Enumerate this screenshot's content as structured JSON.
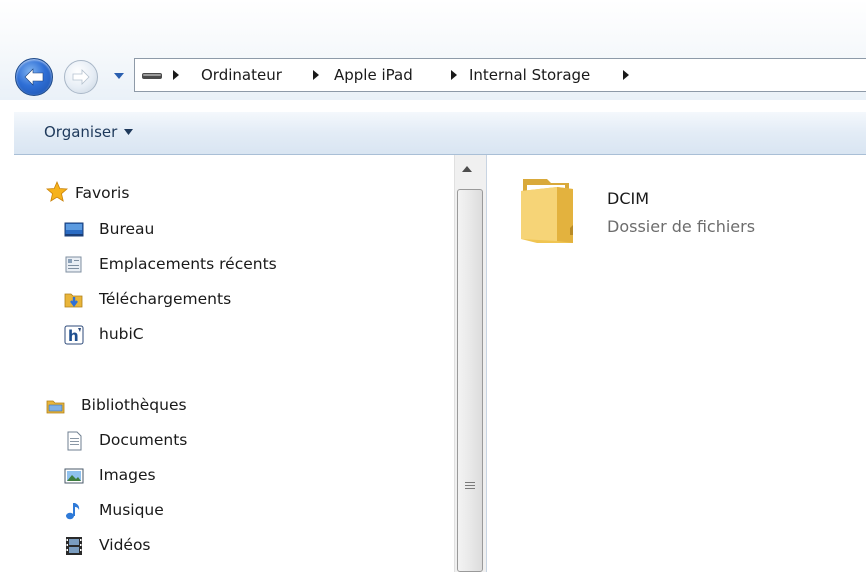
{
  "window": {
    "address_path": [
      "Ordinateur",
      "Apple iPad",
      "Internal Storage"
    ]
  },
  "toolbar": {
    "organise_label": "Organiser"
  },
  "nav": {
    "favorites": {
      "label": "Favoris",
      "items": [
        {
          "label": "Bureau",
          "icon": "desktop-icon"
        },
        {
          "label": "Emplacements récents",
          "icon": "recent-places-icon"
        },
        {
          "label": "Téléchargements",
          "icon": "downloads-icon"
        },
        {
          "label": "hubiC",
          "icon": "hubic-icon"
        }
      ]
    },
    "libraries": {
      "label": "Bibliothèques",
      "items": [
        {
          "label": "Documents",
          "icon": "documents-icon"
        },
        {
          "label": "Images",
          "icon": "images-icon"
        },
        {
          "label": "Musique",
          "icon": "music-icon"
        },
        {
          "label": "Vidéos",
          "icon": "videos-icon"
        }
      ]
    }
  },
  "content": {
    "items": [
      {
        "name": "DCIM",
        "type": "Dossier de fichiers",
        "icon": "folder-icon"
      }
    ]
  },
  "colors": {
    "back_button": "#2f6fd6",
    "toolbar": "#e3ecf6",
    "folder": "#f0c552"
  }
}
